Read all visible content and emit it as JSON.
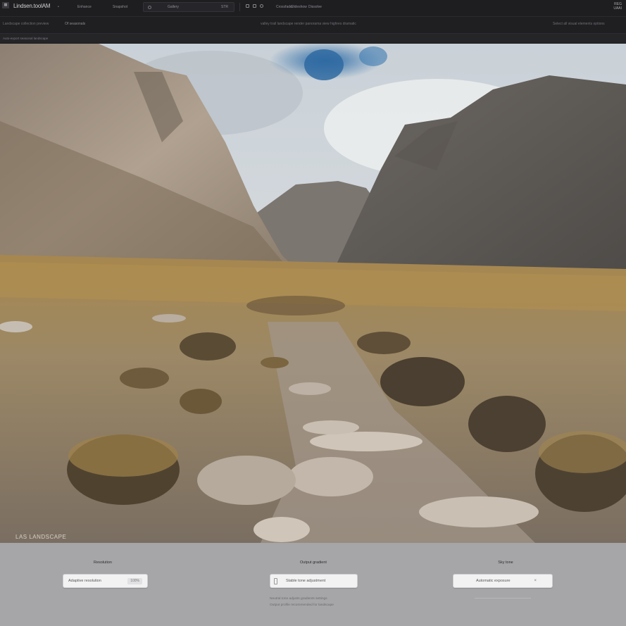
{
  "window": {
    "app_title": "Lindsen.toolAM",
    "menu_1": "Enhance",
    "menu_2": "Snapshot",
    "search_label": "Gallery",
    "search_value": "STR",
    "tools_1": "Crossfade",
    "tools_2": "Slideshow",
    "tools_3": "Dissolve",
    "right_top": "REG",
    "right_bottom": "UAAI"
  },
  "subbar": {
    "left": "Landscape collection preview",
    "left_accent": "Of seasonals",
    "center": "valley trail landscape render panorama view highres dramatic",
    "right": "Select all visual elements options"
  },
  "pathbar": {
    "path": "Auto-export seasonal landscape"
  },
  "viewer": {
    "watermark": "LAS LANDSCAPE"
  },
  "bottom": {
    "col1": {
      "title": "Resolution",
      "field": "Adaptive resolution",
      "badge": "100%"
    },
    "col2": {
      "title": "Output gradient",
      "field": "Stable tone adjustment",
      "note_1": "Neutral tone adjusts gradients settings",
      "note_2": "Output profile recommended for landscape"
    },
    "col3": {
      "title": "Sky tone",
      "field": "Automatic exposure",
      "mark": "×"
    }
  }
}
